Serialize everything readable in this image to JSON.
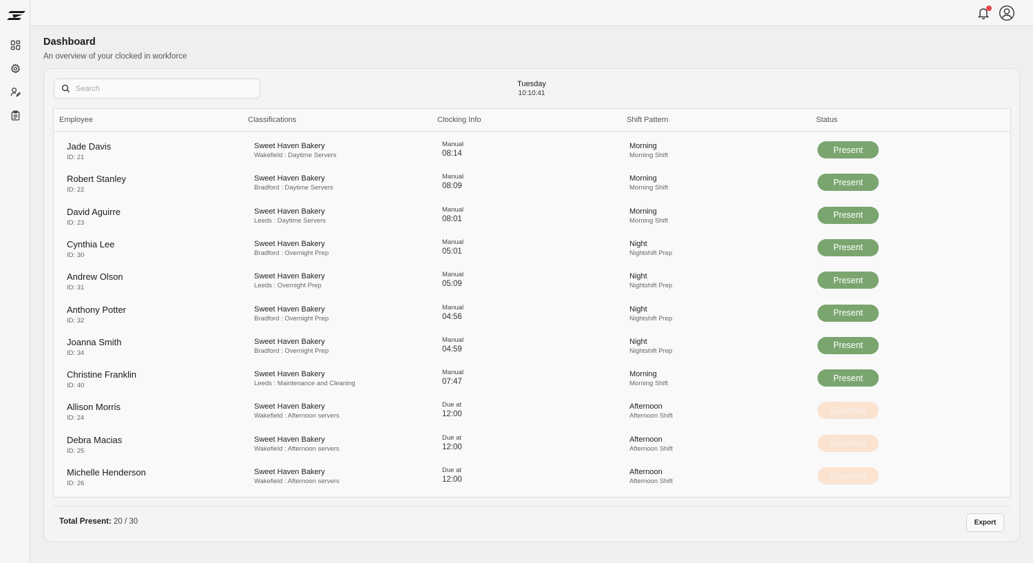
{
  "header": {
    "title": "Dashboard",
    "subtitle": "An overview of your clocked in workforce"
  },
  "sidebar": {
    "items": [
      {
        "icon": "dashboard-grid-icon"
      },
      {
        "icon": "gear-icon"
      },
      {
        "icon": "user-edit-icon"
      },
      {
        "icon": "clipboard-icon"
      }
    ]
  },
  "topbar": {
    "notification_icon": "bell-icon",
    "account_icon": "user-circle-icon"
  },
  "search": {
    "placeholder": "Search",
    "value": ""
  },
  "clock": {
    "day": "Tuesday",
    "time": "10:10:41"
  },
  "table": {
    "columns": [
      "Employee",
      "Classifications",
      "Clocking Info",
      "Shift Pattern",
      "Status"
    ],
    "rows": [
      {
        "name": "Jade Davis",
        "id": "ID: 21",
        "company": "Sweet Haven Bakery",
        "classification": "Wakefield : Daytime Servers",
        "clock_label": "Manual",
        "clock_time": "08:14",
        "shift": "Morning",
        "shift_detail": "Morning Shift",
        "status": "Present"
      },
      {
        "name": "Robert Stanley",
        "id": "ID: 22",
        "company": "Sweet Haven Bakery",
        "classification": "Bradford : Daytime Servers",
        "clock_label": "Manual",
        "clock_time": "08:09",
        "shift": "Morning",
        "shift_detail": "Morning Shift",
        "status": "Present"
      },
      {
        "name": "David Aguirre",
        "id": "ID: 23",
        "company": "Sweet Haven Bakery",
        "classification": "Leeds : Daytime Servers",
        "clock_label": "Manual",
        "clock_time": "08:01",
        "shift": "Morning",
        "shift_detail": "Morning Shift",
        "status": "Present"
      },
      {
        "name": "Cynthia Lee",
        "id": "ID: 30",
        "company": "Sweet Haven Bakery",
        "classification": "Bradford : Overnight Prep",
        "clock_label": "Manual",
        "clock_time": "05:01",
        "shift": "Night",
        "shift_detail": "Nightshift Prep",
        "status": "Present"
      },
      {
        "name": "Andrew Olson",
        "id": "ID: 31",
        "company": "Sweet Haven Bakery",
        "classification": "Leeds : Overnight Prep",
        "clock_label": "Manual",
        "clock_time": "05:09",
        "shift": "Night",
        "shift_detail": "Nightshift Prep",
        "status": "Present"
      },
      {
        "name": "Anthony Potter",
        "id": "ID: 32",
        "company": "Sweet Haven Bakery",
        "classification": "Bradford : Overnight Prep",
        "clock_label": "Manual",
        "clock_time": "04:56",
        "shift": "Night",
        "shift_detail": "Nightshift Prep",
        "status": "Present"
      },
      {
        "name": "Joanna Smith",
        "id": "ID: 34",
        "company": "Sweet Haven Bakery",
        "classification": "Bradford : Overnight Prep",
        "clock_label": "Manual",
        "clock_time": "04:59",
        "shift": "Night",
        "shift_detail": "Nightshift Prep",
        "status": "Present"
      },
      {
        "name": "Christine Franklin",
        "id": "ID: 40",
        "company": "Sweet Haven Bakery",
        "classification": "Leeds : Maintenance and Cleaning",
        "clock_label": "Manual",
        "clock_time": "07:47",
        "shift": "Morning",
        "shift_detail": "Morning Shift",
        "status": "Present"
      },
      {
        "name": "Allison Morris",
        "id": "ID: 24",
        "company": "Sweet Haven Bakery",
        "classification": "Wakefield : Afternoon servers",
        "clock_label": "Due at",
        "clock_time": "12:00",
        "shift": "Afternoon",
        "shift_detail": "Afternoon Shift",
        "status": "Expected"
      },
      {
        "name": "Debra Macias",
        "id": "ID: 25",
        "company": "Sweet Haven Bakery",
        "classification": "Wakefield : Afternoon servers",
        "clock_label": "Due at",
        "clock_time": "12:00",
        "shift": "Afternoon",
        "shift_detail": "Afternoon Shift",
        "status": "Expected"
      },
      {
        "name": "Michelle Henderson",
        "id": "ID: 26",
        "company": "Sweet Haven Bakery",
        "classification": "Wakefield : Afternoon servers",
        "clock_label": "Due at",
        "clock_time": "12:00",
        "shift": "Afternoon",
        "shift_detail": "Afternoon Shift",
        "status": "Expected"
      }
    ]
  },
  "footer": {
    "total_label": "Total Present:",
    "total_value": "20 / 30",
    "export_label": "Export"
  },
  "colors": {
    "present": "#7aa56f",
    "expected": "#fbe3d2",
    "notification_dot": "#e5484d"
  }
}
